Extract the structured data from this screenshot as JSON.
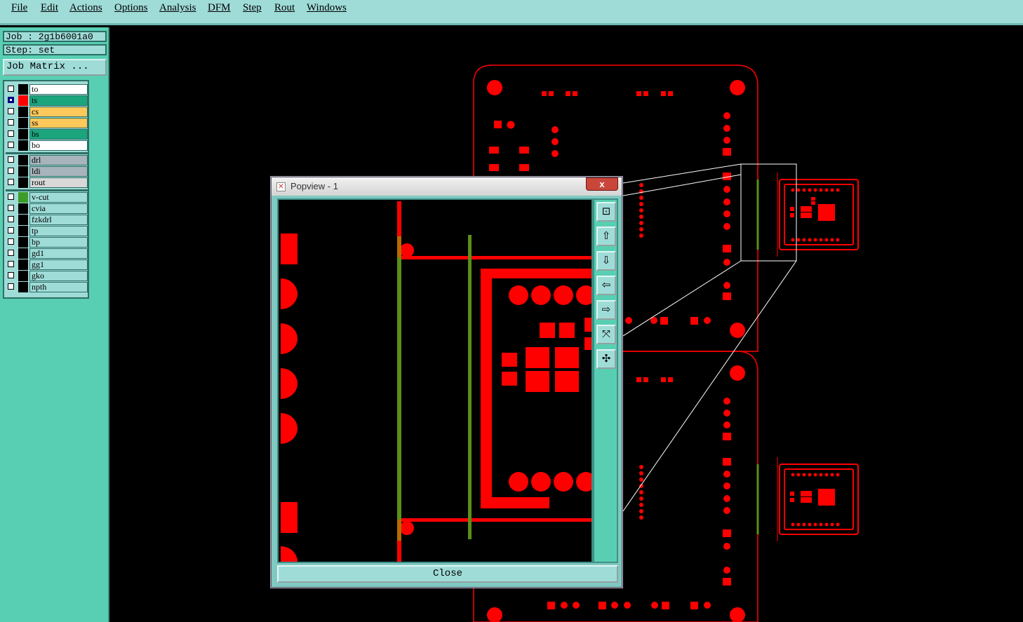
{
  "menubar": {
    "items": [
      {
        "label": "File"
      },
      {
        "label": "Edit"
      },
      {
        "label": "Actions"
      },
      {
        "label": "Options"
      },
      {
        "label": "Analysis"
      },
      {
        "label": "DFM"
      },
      {
        "label": "Step"
      },
      {
        "label": "Rout"
      },
      {
        "label": "Windows"
      }
    ]
  },
  "job": {
    "label": "Job : 2g1b6001a0"
  },
  "step": {
    "label": "Step: set"
  },
  "job_matrix_button": "Job Matrix ...",
  "layers": [
    {
      "name": "to",
      "checked": false,
      "color": "#ffffff",
      "swatch": "#000000"
    },
    {
      "name": "ts",
      "checked": true,
      "color": "#1aa57c",
      "swatch": "#ff0000"
    },
    {
      "name": "cs",
      "checked": false,
      "color": "#ffc85a",
      "swatch": "#000000"
    },
    {
      "name": "ss",
      "checked": false,
      "color": "#ffc85a",
      "swatch": "#000000"
    },
    {
      "name": "bs",
      "checked": false,
      "color": "#1aa57c",
      "swatch": "#000000"
    },
    {
      "name": "bo",
      "checked": false,
      "color": "#ffffff",
      "swatch": "#000000"
    },
    {
      "name": "drl",
      "checked": false,
      "color": "#a7b4bc",
      "swatch": "#000000"
    },
    {
      "name": "ldi",
      "checked": false,
      "color": "#a7b4bc",
      "swatch": "#000000"
    },
    {
      "name": "rout",
      "checked": false,
      "color": "#d8d8d8",
      "swatch": "#000000"
    },
    {
      "name": "v-cut",
      "checked": false,
      "color": "#9fdcd8",
      "swatch": "#3d9c2a"
    },
    {
      "name": "cvia",
      "checked": false,
      "color": "#9fdcd8",
      "swatch": "#000000"
    },
    {
      "name": "fzkdrl",
      "checked": false,
      "color": "#9fdcd8",
      "swatch": "#000000"
    },
    {
      "name": "tp",
      "checked": false,
      "color": "#9fdcd8",
      "swatch": "#000000"
    },
    {
      "name": "bp",
      "checked": false,
      "color": "#9fdcd8",
      "swatch": "#000000"
    },
    {
      "name": "gd1",
      "checked": false,
      "color": "#9fdcd8",
      "swatch": "#000000"
    },
    {
      "name": "gg1",
      "checked": false,
      "color": "#9fdcd8",
      "swatch": "#000000"
    },
    {
      "name": "gko",
      "checked": false,
      "color": "#9fdcd8",
      "swatch": "#000000"
    },
    {
      "name": "npth",
      "checked": false,
      "color": "#9fdcd8",
      "swatch": "#000000"
    }
  ],
  "popview": {
    "title": "Popview - 1",
    "close_x": "x",
    "close_button": "Close",
    "tools": [
      {
        "icon": "zoom-window-icon"
      },
      {
        "icon": "pan-up-icon"
      },
      {
        "icon": "pan-down-icon"
      },
      {
        "icon": "pan-left-icon"
      },
      {
        "icon": "pan-right-icon"
      },
      {
        "icon": "zoom-in-icon"
      },
      {
        "icon": "zoom-out-icon"
      }
    ]
  },
  "colors": {
    "copper": "#ff0000",
    "vcut": "#5a8f1a",
    "panel_bg": "#58cfb2",
    "menu_bg": "#9fdcd8"
  }
}
